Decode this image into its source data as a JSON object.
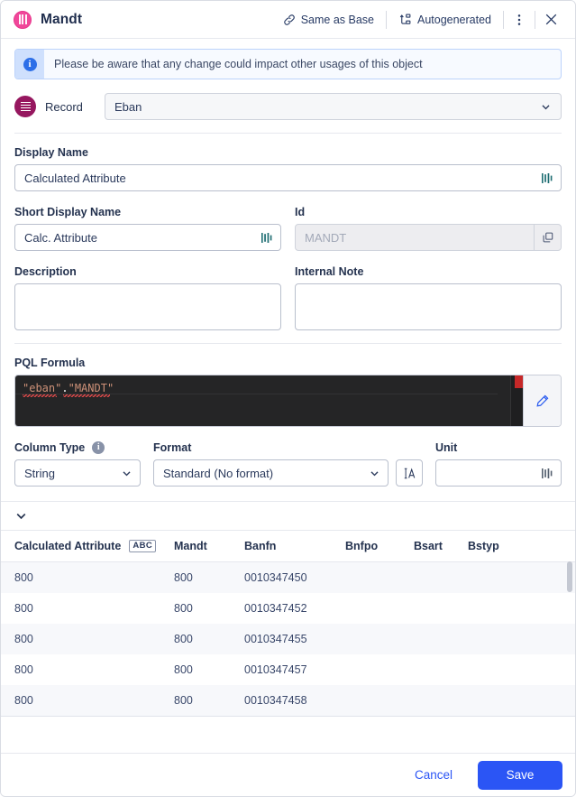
{
  "header": {
    "title": "Mandt",
    "icon": "column-chart-icon",
    "same_as_base_label": "Same as Base",
    "same_as_base_icon": "link-icon",
    "autogenerated_label": "Autogenerated",
    "autogenerated_icon": "autogenerate-icon",
    "more_icon": "more-vertical-icon",
    "close_icon": "close-icon"
  },
  "banner": {
    "icon": "info-icon",
    "text": "Please be aware that any change could impact other usages of this object"
  },
  "record": {
    "icon": "record-table-icon",
    "label": "Record",
    "value": "Eban",
    "chevron": "chevron-down-icon"
  },
  "display_name": {
    "label": "Display Name",
    "value": "Calculated Attribute",
    "icon": "variable-icon"
  },
  "short_display_name": {
    "label": "Short Display Name",
    "value": "Calc. Attribute",
    "icon": "variable-icon"
  },
  "id_field": {
    "label": "Id",
    "placeholder": "MANDT",
    "value": "",
    "copy_icon": "copy-icon"
  },
  "description": {
    "label": "Description",
    "value": ""
  },
  "internal_note": {
    "label": "Internal Note",
    "value": ""
  },
  "pql_formula": {
    "label": "PQL Formula",
    "code_table": "\"eban\"",
    "code_dot": ".",
    "code_column": "\"MANDT\"",
    "edit_icon": "pencil-icon",
    "error_marker_color": "#c62828"
  },
  "column_type": {
    "label": "Column Type",
    "info_icon": "info-icon",
    "value": "String",
    "chevron": "chevron-down-icon"
  },
  "format": {
    "label": "Format",
    "value": "Standard (No format)",
    "chevron": "chevron-down-icon",
    "text_format_icon": "text-format-icon"
  },
  "unit": {
    "label": "Unit",
    "value": "",
    "icon": "variable-icon"
  },
  "collapse": {
    "icon": "chevron-down-icon"
  },
  "preview_table": {
    "columns": [
      {
        "label": "Calculated Attribute",
        "badge": "ABC"
      },
      {
        "label": "Mandt",
        "badge": ""
      },
      {
        "label": "Banfn",
        "badge": ""
      },
      {
        "label": "Bnfpo",
        "badge": ""
      },
      {
        "label": "Bsart",
        "badge": ""
      },
      {
        "label": "Bstyp",
        "badge": ""
      }
    ],
    "rows": [
      [
        "800",
        "800",
        "0010347450",
        "",
        "",
        ""
      ],
      [
        "800",
        "800",
        "0010347452",
        "",
        "",
        ""
      ],
      [
        "800",
        "800",
        "0010347455",
        "",
        "",
        ""
      ],
      [
        "800",
        "800",
        "0010347457",
        "",
        "",
        ""
      ],
      [
        "800",
        "800",
        "0010347458",
        "",
        "",
        ""
      ]
    ]
  },
  "footer": {
    "cancel_label": "Cancel",
    "save_label": "Save",
    "accent_color": "#2b55f5"
  }
}
